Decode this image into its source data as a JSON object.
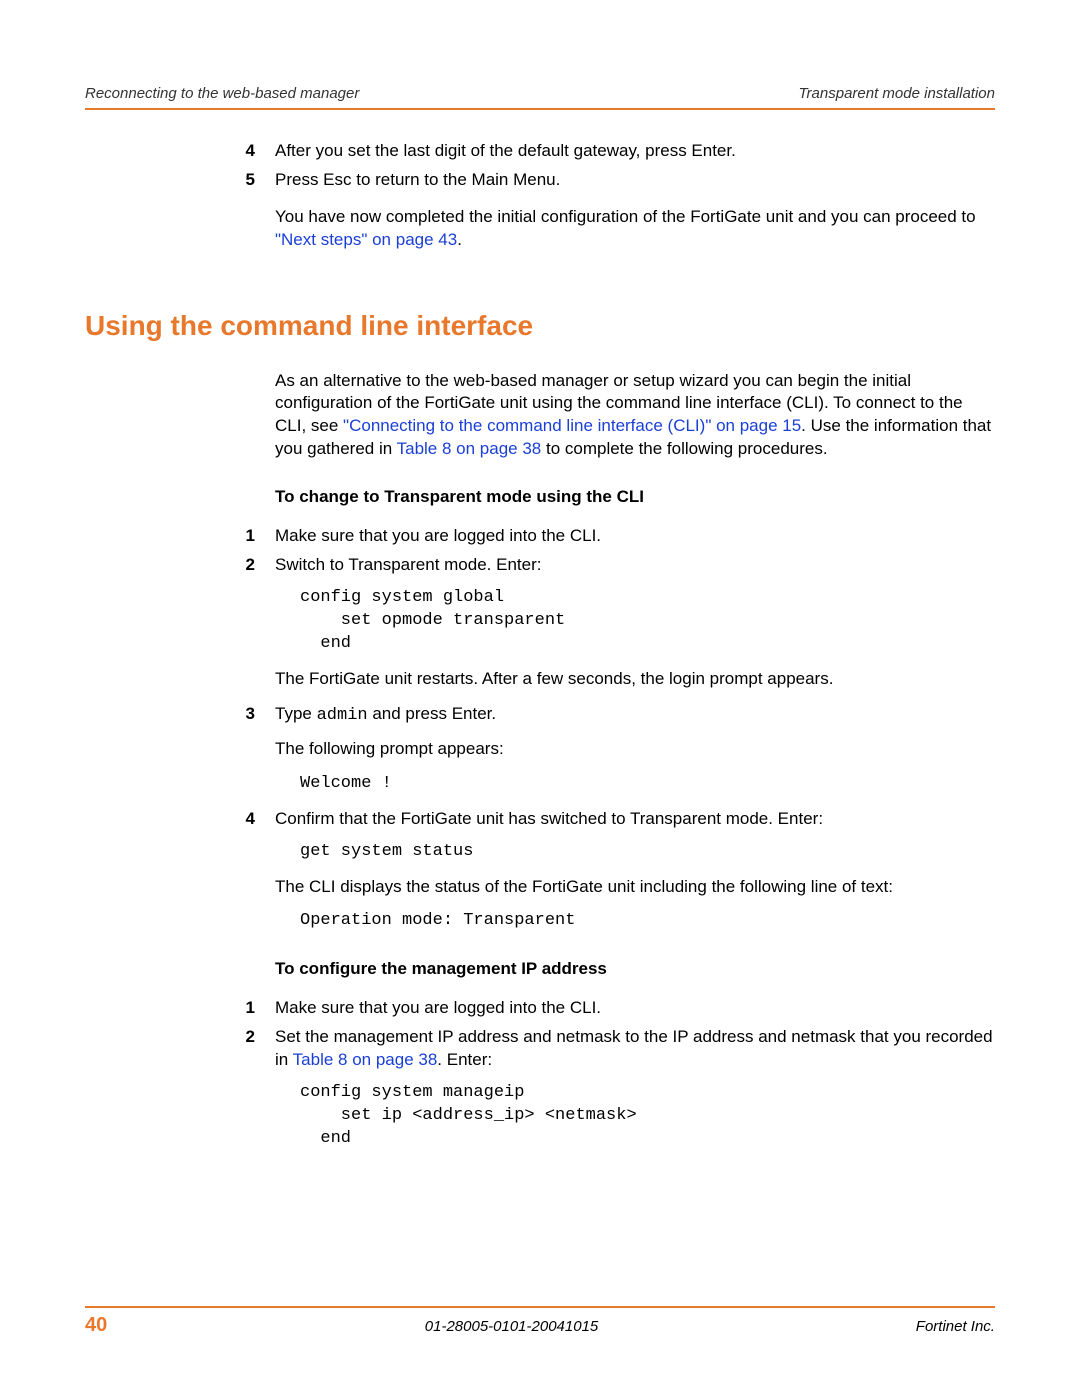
{
  "header": {
    "left": "Reconnecting to the web-based manager",
    "right": "Transparent mode installation"
  },
  "intro_steps": {
    "s4": {
      "num": "4",
      "text": "After you set the last digit of the default gateway, press Enter."
    },
    "s5": {
      "num": "5",
      "text": "Press Esc to return to the Main Menu."
    },
    "completion_pre": "You have now completed the initial configuration of the FortiGate unit and you can proceed to ",
    "completion_link": "\"Next steps\" on page 43",
    "completion_post": "."
  },
  "section_heading": "Using the command line interface",
  "section_intro": {
    "pre": "As an alternative to the web-based manager or setup wizard you can begin the initial configuration of the FortiGate unit using the command line interface (CLI). To connect to the CLI, see ",
    "link1": "\"Connecting to the command line interface (CLI)\" on page 15",
    "mid": ". Use the information that you gathered in ",
    "link2": "Table 8 on page 38",
    "post": " to complete the following procedures."
  },
  "sub1": "To change to Transparent mode using the CLI",
  "t1": {
    "s1": {
      "num": "1",
      "text": "Make sure that you are logged into the CLI."
    },
    "s2": {
      "num": "2",
      "text": "Switch to Transparent mode. Enter:"
    },
    "code1": "config system global\n    set opmode transparent\n  end",
    "after_code1": "The FortiGate unit restarts. After a few seconds, the login prompt appears.",
    "s3": {
      "num": "3",
      "pre": "Type ",
      "mono": "admin",
      "post": " and press Enter."
    },
    "prompt_text": "The following prompt appears:",
    "code2": "Welcome !",
    "s4": {
      "num": "4",
      "text": "Confirm that the FortiGate unit has switched to Transparent mode. Enter:"
    },
    "code3": "get system status",
    "after_code3": "The CLI displays the status of the FortiGate unit including the following line of text:",
    "code4": "Operation mode: Transparent"
  },
  "sub2": "To configure the management IP address",
  "t2": {
    "s1": {
      "num": "1",
      "text": "Make sure that you are logged into the CLI."
    },
    "s2": {
      "num": "2",
      "pre": "Set the management IP address and netmask to the IP address and netmask that you recorded in ",
      "link": "Table 8 on page 38",
      "post": ". Enter:"
    },
    "code1": "config system manageip\n    set ip <address_ip> <netmask>\n  end"
  },
  "footer": {
    "page": "40",
    "doc_id": "01-28005-0101-20041015",
    "company": "Fortinet Inc."
  }
}
